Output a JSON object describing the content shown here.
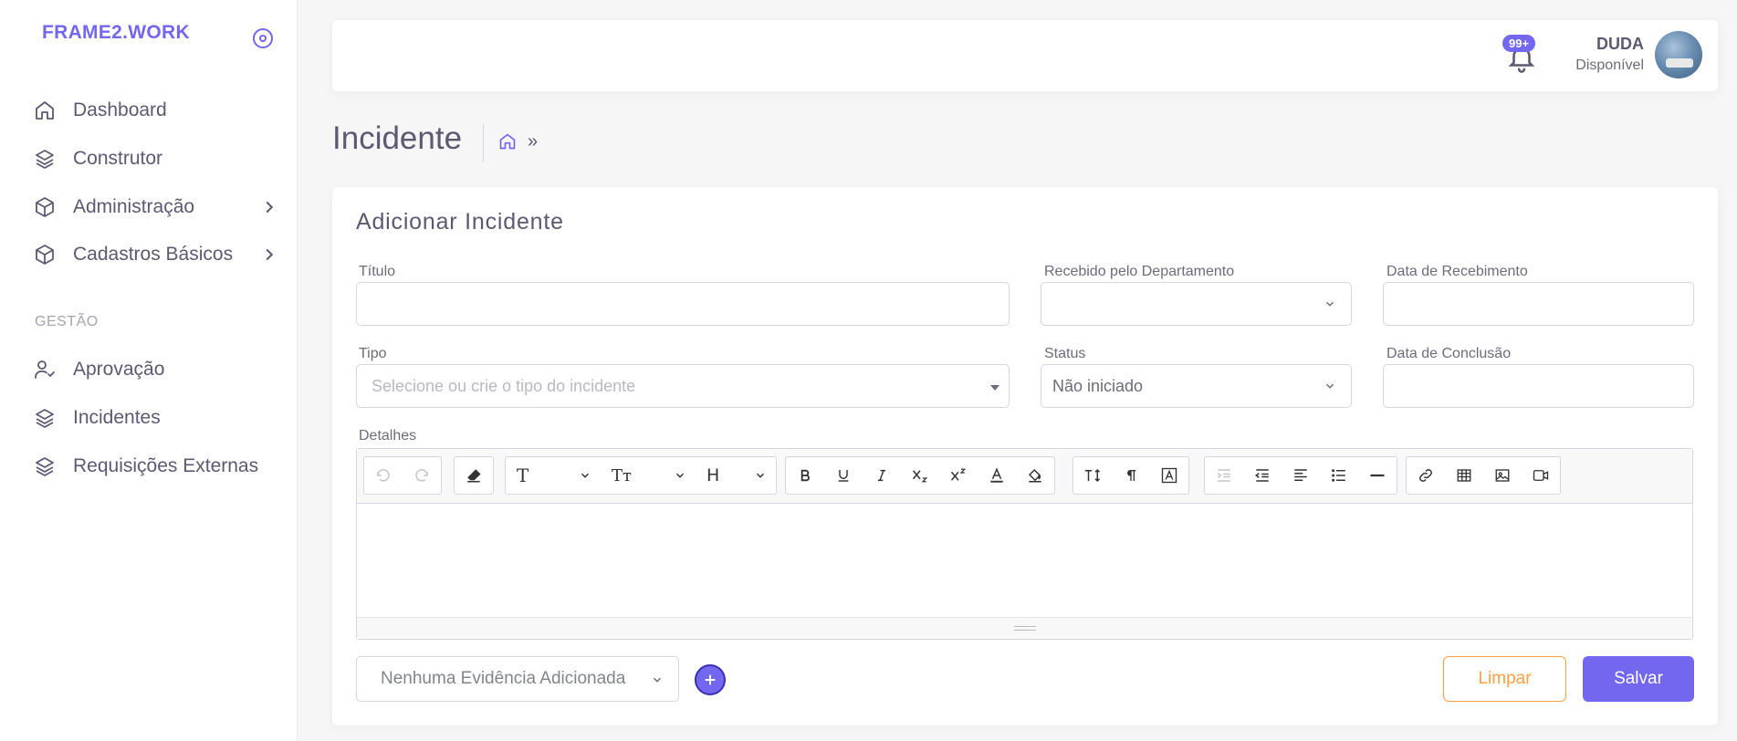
{
  "brand": {
    "name": "FRAME2.WORK"
  },
  "sidebar": {
    "items": [
      {
        "label": "Dashboard",
        "icon": "home-icon"
      },
      {
        "label": "Construtor",
        "icon": "layers-icon"
      },
      {
        "label": "Administração",
        "icon": "box-icon",
        "has_submenu": true
      },
      {
        "label": "Cadastros Básicos",
        "icon": "box-icon",
        "has_submenu": true
      }
    ],
    "section_title": "GESTÃO",
    "section_items": [
      {
        "label": "Aprovação",
        "icon": "user-check-icon"
      },
      {
        "label": "Incidentes",
        "icon": "layers-icon"
      },
      {
        "label": "Requisições Externas",
        "icon": "layers-icon"
      }
    ]
  },
  "topbar": {
    "notification_count": "99+",
    "user_name": "DUDA",
    "user_status": "Disponível"
  },
  "page": {
    "title": "Incidente",
    "breadcrumb_separator": "»"
  },
  "form": {
    "title": "Adicionar Incidente",
    "titulo": {
      "label": "Título",
      "value": ""
    },
    "departamento": {
      "label": "Recebido pelo Departamento",
      "value": ""
    },
    "data_recebimento": {
      "label": "Data de Recebimento",
      "value": ""
    },
    "tipo": {
      "label": "Tipo",
      "placeholder": "Selecione ou crie o tipo do incidente"
    },
    "status": {
      "label": "Status",
      "value": "Não iniciado"
    },
    "data_conclusao": {
      "label": "Data de Conclusão",
      "value": ""
    },
    "detalhes": {
      "label": "Detalhes",
      "value": ""
    },
    "evidencias": {
      "value": "Nenhuma Evidência Adicionada"
    },
    "clear_label": "Limpar",
    "save_label": "Salvar"
  },
  "editor_toolbar": {
    "font_family": "T",
    "font_size": "Tт",
    "heading": "H",
    "buttons": [
      "undo",
      "redo",
      "eraser",
      "bold",
      "underline",
      "italic",
      "subscript",
      "superscript",
      "font-color",
      "highlight",
      "line-height",
      "paragraph",
      "text-frame",
      "outdent",
      "indent",
      "align",
      "list",
      "horizontal-rule",
      "link",
      "table",
      "image",
      "video"
    ]
  },
  "colors": {
    "accent": "#7367f0",
    "warning": "#ff9f43",
    "text": "#5e5873"
  }
}
